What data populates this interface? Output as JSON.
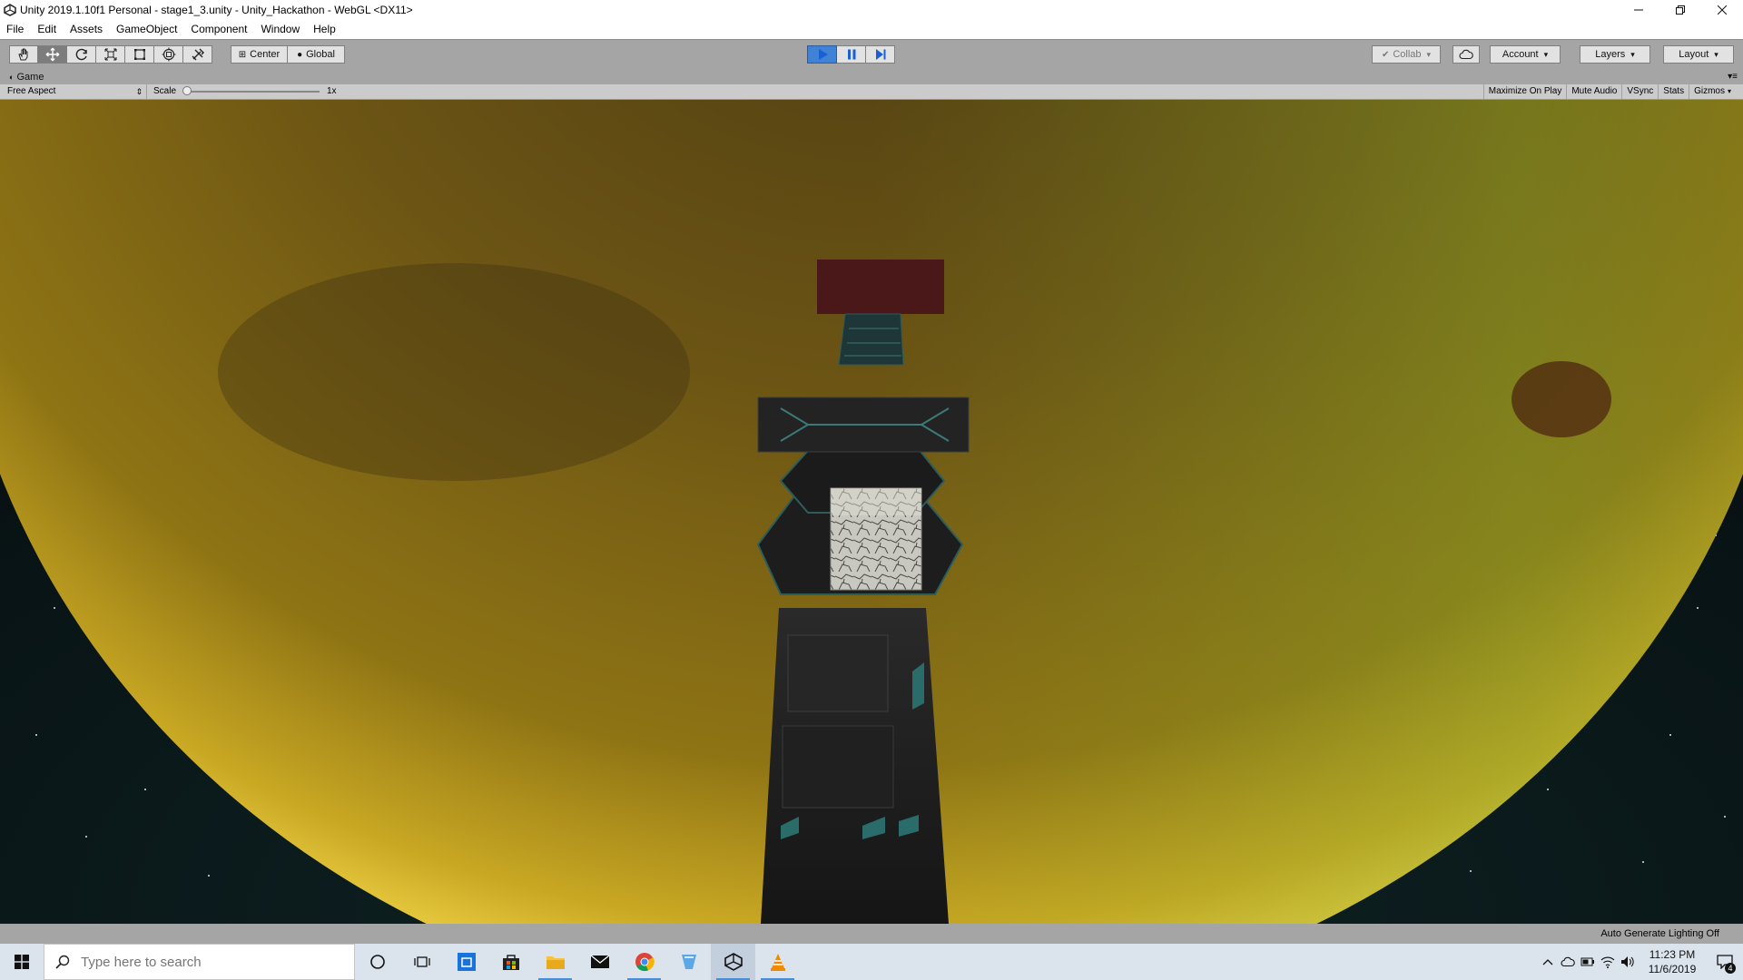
{
  "window": {
    "title": "Unity 2019.1.10f1 Personal - stage1_3.unity - Unity_Hackathon - WebGL <DX11>",
    "icon": "unity-icon",
    "controls": [
      "minimize-icon",
      "restore-icon",
      "close-icon"
    ]
  },
  "menu": [
    "File",
    "Edit",
    "Assets",
    "GameObject",
    "Component",
    "Window",
    "Help"
  ],
  "toolbar": {
    "tools": [
      "hand-tool-icon",
      "move-tool-icon",
      "rotate-tool-icon",
      "scale-tool-icon",
      "rect-tool-icon",
      "transform-tool-icon",
      "custom-tool-icon"
    ],
    "active_tool": "move-tool-icon",
    "pivot_mode": "Center",
    "pivot_rotation": "Global",
    "playback": {
      "play": "play-icon",
      "pause": "pause-icon",
      "step": "step-icon",
      "playing": true
    },
    "collab": "Collab",
    "account": "Account",
    "layers": "Layers",
    "layout": "Layout"
  },
  "game_panel": {
    "tab_title": "Game",
    "aspect": "Free Aspect",
    "scale_label": "Scale",
    "scale_value": "1x",
    "toggles": [
      "Maximize On Play",
      "Mute Audio",
      "VSync",
      "Stats",
      "Gizmos"
    ]
  },
  "status": {
    "text": "Auto Generate Lighting Off"
  },
  "taskbar": {
    "search_placeholder": "Type here to search",
    "apps": [
      "cortana-icon",
      "task-view-icon",
      "store-blue-icon",
      "microsoft-store-icon",
      "file-explorer-icon",
      "mail-icon",
      "chrome-icon",
      "blue-app-icon",
      "unity-icon",
      "vlc-icon"
    ],
    "tray": [
      "chevron-up-icon",
      "cloud-icon",
      "battery-icon",
      "wifi-icon",
      "volume-icon"
    ],
    "time": "11:23 PM",
    "date": "11/6/2019",
    "notifications": "4"
  },
  "colors": {
    "play_active": "#3f82d6",
    "planet": "#8a7015",
    "planet_rim": "#f3d341"
  }
}
